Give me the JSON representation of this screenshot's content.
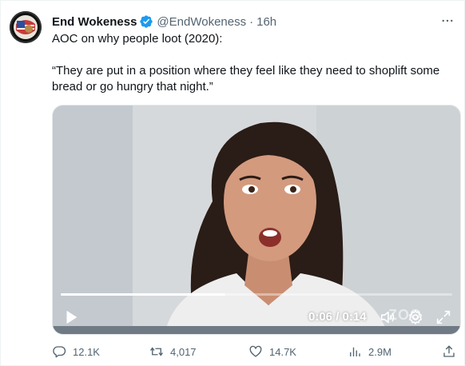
{
  "tweet": {
    "display_name": "End Wokeness",
    "handle": "@EndWokeness",
    "separator": "·",
    "time": "16h",
    "text_line1": "AOC on why people loot (2020):",
    "text_line2": "“They are put in a position where they feel like they need to shoplift some bread or go hungry that night.”"
  },
  "video": {
    "timecode": "0:06 / 0:14",
    "progress": 0.42,
    "watermark": "ZOO"
  },
  "actions": {
    "reply_count": "12.1K",
    "retweet_count": "4,017",
    "like_count": "14.7K",
    "views_count": "2.9M"
  },
  "icons": {
    "verified": "verified-badge-icon",
    "more": "more-icon",
    "play": "play-icon",
    "volume": "volume-icon",
    "settings": "settings-icon",
    "fullscreen": "fullscreen-icon",
    "reply": "reply-icon",
    "retweet": "retweet-icon",
    "like": "like-icon",
    "views": "views-icon",
    "share": "share-icon"
  },
  "colors": {
    "verified": "#1d9bf0",
    "secondary_text": "#536471",
    "primary_text": "#0f1419"
  }
}
